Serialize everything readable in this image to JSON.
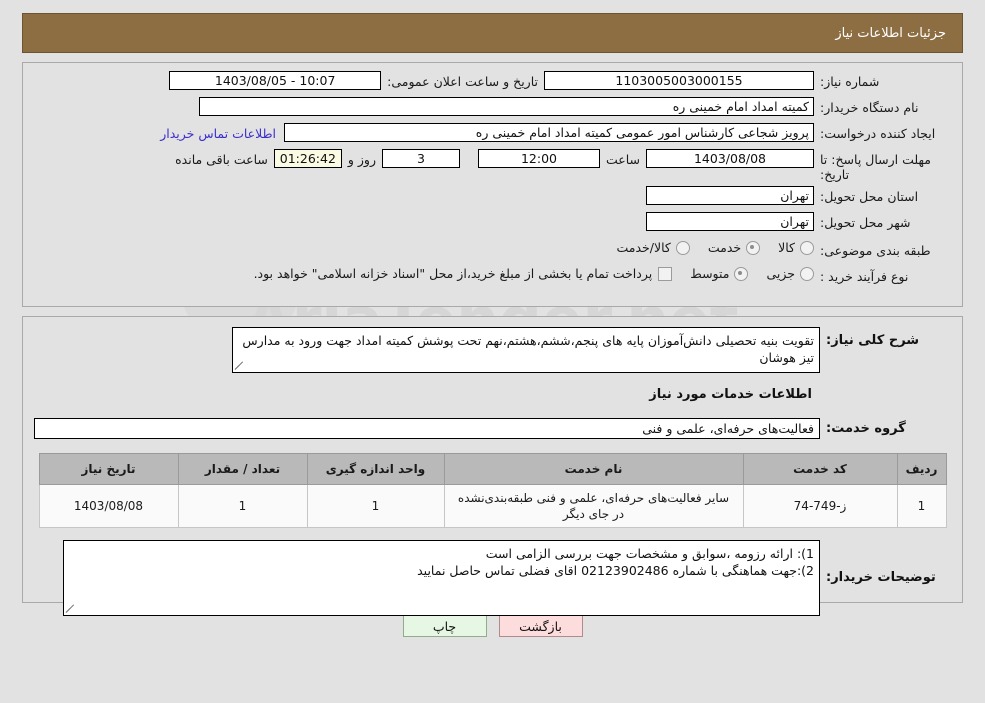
{
  "header": {
    "title": "جزئیات اطلاعات نیاز"
  },
  "watermark": {
    "text": "AriaTender.net"
  },
  "form": {
    "need_number": {
      "label": "شماره نیاز:",
      "value": "1103005003000155"
    },
    "buyer_org": {
      "label": "نام دستگاه خریدار:",
      "value": "کمیته امداد امام خمینی ره"
    },
    "request_creator": {
      "label": "ایجاد کننده درخواست:",
      "value": "پرویز شجاعی کارشناس امور عمومی کمیته امداد امام خمینی ره"
    },
    "buyer_contact_link": "اطلاعات تماس خریدار",
    "public_announce": {
      "label": "تاریخ و ساعت اعلان عمومی:",
      "value": "1403/08/05 - 10:07"
    },
    "reply_deadline": {
      "label": "مهلت ارسال پاسخ: تا تاریخ:",
      "date": "1403/08/08",
      "hour_label": "ساعت",
      "hour": "12:00",
      "days": "3",
      "days_label": "روز و",
      "timer": "01:26:42",
      "timer_label": "ساعت باقی مانده"
    },
    "delivery_province": {
      "label": "استان محل تحویل:",
      "value": "تهران"
    },
    "delivery_city": {
      "label": "شهر محل تحویل:",
      "value": "تهران"
    },
    "subject_classification": {
      "label": "طبقه بندی موضوعی:",
      "options": [
        {
          "text": "کالا",
          "selected": false
        },
        {
          "text": "خدمت",
          "selected": true
        },
        {
          "text": "کالا/خدمت",
          "selected": false
        }
      ]
    },
    "purchase_process": {
      "label": "نوع فرآیند خرید :",
      "options": [
        {
          "text": "جزیی",
          "selected": false
        },
        {
          "text": "متوسط",
          "selected": true
        }
      ],
      "checkbox_note": "پرداخت تمام یا بخشی از مبلغ خرید،از محل \"اسناد خزانه اسلامی\" خواهد بود.",
      "checkbox_checked": false
    },
    "general_description": {
      "label": "شرح کلی نیاز:",
      "value": "تقویت بنیه تحصیلی دانش‌آموزان پایه های پنجم،ششم،هشتم،نهم تحت پوشش کمیته امداد جهت ورود به مدارس تیز هوشان"
    },
    "services_heading": "اطلاعات خدمات مورد نیاز",
    "service_group": {
      "label": "گروه خدمت:",
      "value": "فعالیت‌های حرفه‌ای، علمی و فنی"
    },
    "buyer_notes": {
      "label": "توضیحات خریدار:",
      "value": "1): ارائه رزومه ،سوابق و مشخصات جهت بررسی الزامی است\n2):جهت هماهنگی با شماره 02123902486 اقای فضلی تماس حاصل نمایید"
    }
  },
  "items_table": {
    "columns": [
      "ردیف",
      "کد خدمت",
      "نام خدمت",
      "واحد اندازه گیری",
      "تعداد / مقدار",
      "تاریخ نیاز"
    ],
    "rows": [
      {
        "row_no": "1",
        "service_code": "ز-749-74",
        "service_name": "سایر فعالیت‌های حرفه‌ای، علمی و فنی طبقه‌بندی‌نشده در جای دیگر",
        "unit": "1",
        "quantity": "1",
        "need_date": "1403/08/08"
      }
    ]
  },
  "buttons": {
    "print": "چاپ",
    "back": "بازگشت"
  }
}
